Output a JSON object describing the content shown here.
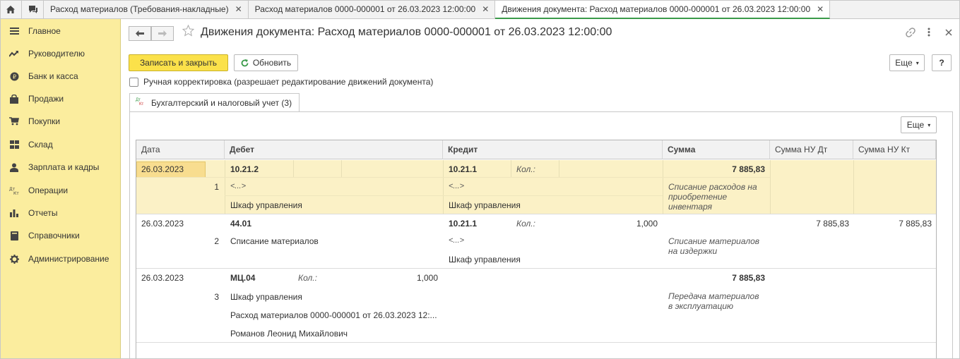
{
  "topbar": {
    "tabs": [
      {
        "label": "Расход материалов (Требования-накладные)"
      },
      {
        "label": "Расход материалов 0000-000001 от 26.03.2023 12:00:00"
      },
      {
        "label": "Движения документа: Расход материалов 0000-000001 от 26.03.2023 12:00:00"
      }
    ],
    "close_glyph": "✕"
  },
  "sidebar": {
    "items": [
      {
        "label": "Главное",
        "icon": "menu-icon"
      },
      {
        "label": "Руководителю",
        "icon": "trend-icon"
      },
      {
        "label": "Банк и касса",
        "icon": "coin-icon"
      },
      {
        "label": "Продажи",
        "icon": "bag-icon"
      },
      {
        "label": "Покупки",
        "icon": "cart-icon"
      },
      {
        "label": "Склад",
        "icon": "warehouse-icon"
      },
      {
        "label": "Зарплата и кадры",
        "icon": "person-icon"
      },
      {
        "label": "Операции",
        "icon": "dt-kt-icon"
      },
      {
        "label": "Отчеты",
        "icon": "bar-chart-icon"
      },
      {
        "label": "Справочники",
        "icon": "book-icon"
      },
      {
        "label": "Администрирование",
        "icon": "gear-icon"
      }
    ]
  },
  "header": {
    "title": "Движения документа: Расход материалов 0000-000001 от 26.03.2023 12:00:00"
  },
  "toolbar": {
    "save_close": "Записать и закрыть",
    "refresh": "Обновить",
    "more": "Еще",
    "help": "?"
  },
  "manual_edit": {
    "label": "Ручная корректировка (разрешает редактирование движений документа)",
    "checked": false
  },
  "subtab": {
    "label": "Бухгалтерский и налоговый учет (3)",
    "icon_top": "Дт",
    "icon_bottom": "Кт"
  },
  "table": {
    "more": "Еще",
    "headers": [
      "Дата",
      "Дебет",
      "Кредит",
      "Сумма",
      "Сумма НУ Дт",
      "Сумма НУ Кт"
    ],
    "rows": [
      {
        "date": "26.03.2023",
        "num": "1",
        "debit_account": "10.21.2",
        "debit_qty_label": "",
        "debit_qty": "",
        "debit_sub1": "<...>",
        "debit_sub2": "Шкаф управления",
        "debit_sub3": "",
        "debit_sub4": "",
        "credit_account": "10.21.1",
        "credit_qty_label": "Кол.:",
        "credit_qty": "",
        "credit_sub1": "<...>",
        "credit_sub2": "Шкаф управления",
        "sum": "7 885,83",
        "comment": "Списание расходов на приобретение инвентаря",
        "nu_dt": "",
        "nu_kt": ""
      },
      {
        "date": "26.03.2023",
        "num": "2",
        "debit_account": "44.01",
        "debit_qty_label": "",
        "debit_qty": "",
        "debit_sub1": "Списание материалов",
        "debit_sub2": "",
        "debit_sub3": "",
        "debit_sub4": "",
        "credit_account": "10.21.1",
        "credit_qty_label": "Кол.:",
        "credit_qty": "1,000",
        "credit_sub1": "<...>",
        "credit_sub2": "Шкаф управления",
        "sum": "",
        "comment": "Списание материалов на издержки",
        "nu_dt": "7 885,83",
        "nu_kt": "7 885,83"
      },
      {
        "date": "26.03.2023",
        "num": "3",
        "debit_account": "МЦ.04",
        "debit_qty_label": "Кол.:",
        "debit_qty": "1,000",
        "debit_sub1": "Шкаф управления",
        "debit_sub2": "Расход материалов 0000-000001 от 26.03.2023 12:...",
        "debit_sub3": "Романов Леонид Михайлович",
        "debit_sub4": "",
        "credit_account": "",
        "credit_qty_label": "",
        "credit_qty": "",
        "credit_sub1": "",
        "credit_sub2": "",
        "sum": "7 885,83",
        "comment": "Передача материалов в эксплуатацию",
        "nu_dt": "",
        "nu_kt": ""
      }
    ]
  },
  "colors": {
    "sidebar_bg": "#fbed9e",
    "primary_button": "#fbe14a",
    "selected_row": "#fbf1c6",
    "active_tab_underline": "#3a9a4a"
  }
}
